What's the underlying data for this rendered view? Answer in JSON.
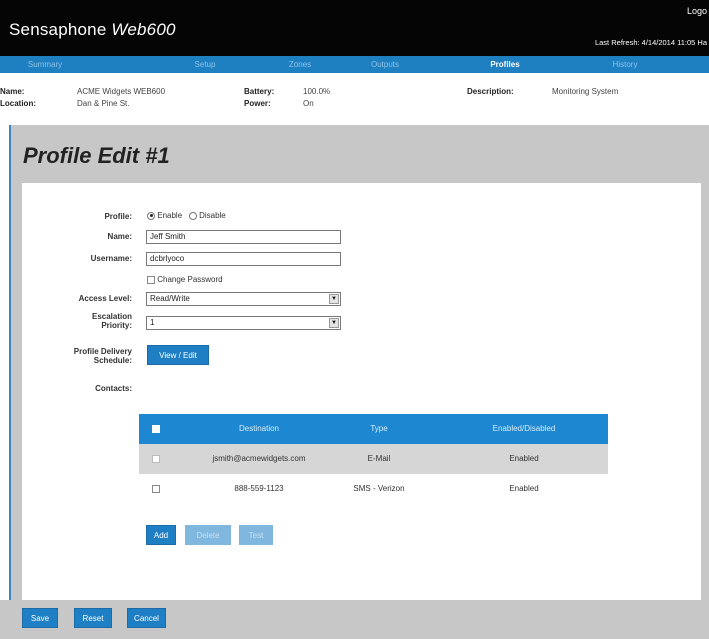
{
  "header": {
    "brand": "Sensaphone",
    "model": "Web600",
    "logout": "Logo",
    "last_refresh": "Last Refresh: 4/14/2014 11:05 Ha"
  },
  "nav": {
    "tabs": [
      {
        "label": "Summary",
        "active": false
      },
      {
        "label": "Setup",
        "active": false
      },
      {
        "label": "Zones",
        "active": false
      },
      {
        "label": "Outputs",
        "active": false
      },
      {
        "label": "Profiles",
        "active": true
      },
      {
        "label": "History",
        "active": false
      }
    ]
  },
  "device_info": {
    "name_label": "Name:",
    "name_value": "ACME Widgets WEB600",
    "location_label": "Location:",
    "location_value": "Dan & Pine St.",
    "battery_label": "Battery:",
    "battery_value": "100.0%",
    "power_label": "Power:",
    "power_value": "On",
    "description_label": "Description:",
    "description_value": "Monitoring System"
  },
  "page": {
    "title": "Profile Edit #1"
  },
  "form": {
    "profile_label": "Profile:",
    "enable_label": "Enable",
    "disable_label": "Disable",
    "profile_selected": "Enable",
    "name_label": "Name:",
    "name_value": "Jeff Smith",
    "username_label": "Username:",
    "username_value": "dcbrlyoco",
    "change_password_label": "Change Password",
    "access_level_label": "Access Level:",
    "access_level_value": "Read/Write",
    "escalation_label_1": "Escalation",
    "escalation_label_2": "Priority:",
    "escalation_value": "1",
    "delivery_label_1": "Profile Delivery",
    "delivery_label_2": "Schedule:",
    "view_edit_button": "View / Edit",
    "contacts_label": "Contacts:"
  },
  "contacts": {
    "columns": [
      "Destination",
      "Type",
      "Enabled/Disabled"
    ],
    "rows": [
      {
        "destination": "jsmith@acmewidgets.com",
        "type": "E-Mail",
        "status": "Enabled"
      },
      {
        "destination": "888-559-1123",
        "type": "SMS - Verizon",
        "status": "Enabled"
      }
    ],
    "add_button": "Add",
    "delete_button": "Delete",
    "test_button": "Test"
  },
  "footer": {
    "save_button": "Save",
    "reset_button": "Reset",
    "cancel_button": "Cancel"
  },
  "colors": {
    "header_bg": "#050505",
    "accent_blue": "#1e7fc1",
    "panel_gray": "#c7c7c7"
  }
}
